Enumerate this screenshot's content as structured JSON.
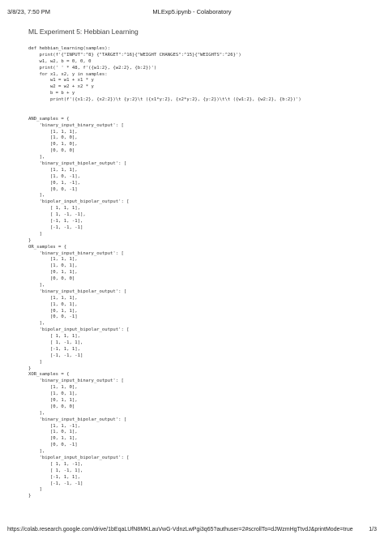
{
  "header": {
    "datetime": "3/8/23, 7:50 PM",
    "title": "MLExp5.ipynb - Colaboratory"
  },
  "notebook": {
    "cell_title": "ML Experiment 5: Hebbian Learning",
    "code_lines": [
      "def hebbian_learning(samples):",
      "    print(f'{\"INPUT\":^8} {\"TARGET\":^16}{\"WEIGHT CHANGES\":^15}{\"WEIGHTS\":^26}')",
      "    w1, w2, b = 0, 0, 0",
      "    print(' ' * 48, f'({w1:2}, {w2:2}, {b:2})')",
      "    for x1, x2, y in samples:",
      "        w1 = w1 + x1 * y",
      "        w2 = w2 + x2 * y",
      "        b = b + y",
      "        print(f'({x1:2}, {x2:2})\\t {y:2}\\t ({x1*y:2}, {x2*y:2}, {y:2})\\t\\t ({w1:2}, {w2:2}, {b:2})')",
      "",
      "",
      "AND_samples = {",
      "    'binary_input_binary_output': [",
      "        [1, 1, 1],",
      "        [1, 0, 0],",
      "        [0, 1, 0],",
      "        [0, 0, 0]",
      "    ],",
      "    'binary_input_bipolar_output': [",
      "        [1, 1, 1],",
      "        [1, 0, -1],",
      "        [0, 1, -1],",
      "        [0, 0, -1]",
      "    ],",
      "    'bipolar_input_bipolar_output': [",
      "        [ 1, 1, 1],",
      "        [ 1, -1, -1],",
      "        [-1, 1, -1],",
      "        [-1, -1, -1]",
      "    ]",
      "}",
      "OR_samples = {",
      "    'binary_input_binary_output': [",
      "        [1, 1, 1],",
      "        [1, 0, 1],",
      "        [0, 1, 1],",
      "        [0, 0, 0]",
      "    ],",
      "    'binary_input_bipolar_output': [",
      "        [1, 1, 1],",
      "        [1, 0, 1],",
      "        [0, 1, 1],",
      "        [0, 0, -1]",
      "    ],",
      "    'bipolar_input_bipolar_output': [",
      "        [ 1, 1, 1],",
      "        [ 1, -1, 1],",
      "        [-1, 1, 1],",
      "        [-1, -1, -1]",
      "    ]",
      "}",
      "XOR_samples = {",
      "    'binary_input_binary_output': [",
      "        [1, 1, 0],",
      "        [1, 0, 1],",
      "        [0, 1, 1],",
      "        [0, 0, 0]",
      "    ],",
      "    'binary_input_bipolar_output': [",
      "        [1, 1, -1],",
      "        [1, 0, 1],",
      "        [0, 1, 1],",
      "        [0, 0, -1]",
      "    ],",
      "    'bipolar_input_bipolar_output': [",
      "        [ 1, 1, -1],",
      "        [ 1, -1, 1],",
      "        [-1, 1, 1],",
      "        [-1, -1, -1]",
      "    ]",
      "}"
    ]
  },
  "footer": {
    "url": "https://colab.research.google.com/drive/1bEqaLUfN8MKLauVwG-VdnzLwPgi3q65?authuser=2#scrollTo=dJWzmHgTtvdJ&printMode=true",
    "page_number": "1/3"
  }
}
